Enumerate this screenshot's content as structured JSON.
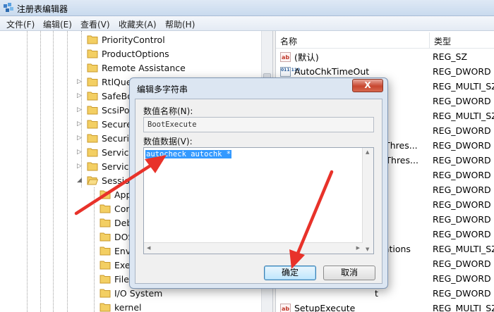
{
  "window": {
    "title": "注册表编辑器"
  },
  "menu": [
    "文件(F)",
    "编辑(E)",
    "查看(V)",
    "收藏夹(A)",
    "帮助(H)"
  ],
  "tree": {
    "items": [
      "PriorityControl",
      "ProductOptions",
      "Remote Assistance",
      "RtlQuer",
      "SafeBo",
      "ScsiPor",
      "SecureB",
      "Security",
      "Service",
      "Service",
      "Sessio",
      "App",
      "Cor",
      "Deb",
      "DOS",
      "Envi",
      "Exe",
      "FileR",
      "I/O System",
      "kernel"
    ]
  },
  "list": {
    "columns": [
      "名称",
      "类型"
    ],
    "rows": [
      {
        "name": "(默认)",
        "type": "REG_SZ",
        "icon": "string-value-icon"
      },
      {
        "name": "AutoChkTimeOut",
        "type": "REG_DWORD",
        "icon": "binary-value-icon"
      },
      {
        "name": "",
        "type": "REG_MULTI_SZ",
        "icon": ""
      },
      {
        "name": "",
        "type": "REG_DWORD",
        "icon": ""
      },
      {
        "name": "",
        "type": "REG_MULTI_SZ",
        "icon": ""
      },
      {
        "name": "",
        "type": "REG_DWORD",
        "icon": ""
      },
      {
        "name": "ckThres...",
        "type": "REG_DWORD",
        "icon": ""
      },
      {
        "name": "eeThres...",
        "type": "REG_DWORD",
        "icon": ""
      },
      {
        "name": "",
        "type": "REG_DWORD",
        "icon": ""
      },
      {
        "name": "",
        "type": "REG_DWORD",
        "icon": ""
      },
      {
        "name": "",
        "type": "REG_DWORD",
        "icon": ""
      },
      {
        "name": "ns",
        "type": "REG_DWORD",
        "icon": ""
      },
      {
        "name": "",
        "type": "REG_DWORD",
        "icon": ""
      },
      {
        "name": "erations",
        "type": "REG_MULTI_SZ",
        "icon": ""
      },
      {
        "name": "",
        "type": "REG_DWORD",
        "icon": ""
      },
      {
        "name": "",
        "type": "REG_DWORD",
        "icon": ""
      },
      {
        "name": "t",
        "type": "REG_DWORD",
        "icon": ""
      },
      {
        "name": "SetupExecute",
        "type": "REG_MULTI_SZ",
        "icon": "string-value-icon"
      }
    ]
  },
  "dialog": {
    "title": "编辑多字符串",
    "close_label": "X",
    "value_name_label": "数值名称(N):",
    "value_name": "BootExecute",
    "value_data_label": "数值数据(V):",
    "value_data": "autocheck autochk *",
    "ok_label": "确定",
    "cancel_label": "取消"
  },
  "colors": {
    "annotation_arrow": "#e8322a",
    "selection": "#3399ff",
    "dialog_frame": "#dce6f2"
  }
}
